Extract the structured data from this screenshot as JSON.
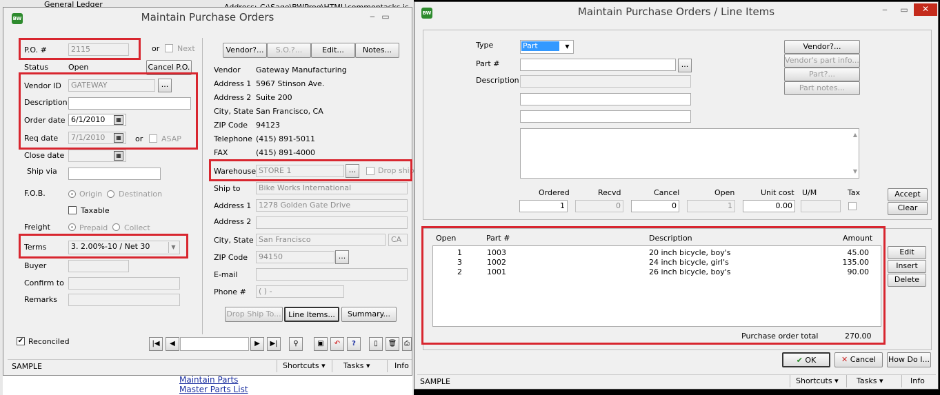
{
  "bg": {
    "gl_label": "General Ledger",
    "address_label": "Address:",
    "address_value": "C:\\Sage\\BWProg\\HTML\\commontasks.js.htm",
    "link1": "Maintain Parts",
    "link2": "Master Parts List"
  },
  "left": {
    "title": "Maintain Purchase Orders",
    "po_label": "P.O. #",
    "po_value": "2115",
    "or1": "or",
    "next": "Next",
    "status_label": "Status",
    "status_value": "Open",
    "cancel_po": "Cancel P.O.",
    "vendor_id_label": "Vendor ID",
    "vendor_id_value": "GATEWAY",
    "description_label": "Description",
    "description_value": "",
    "order_date_label": "Order date",
    "order_date_value": "6/1/2010",
    "req_date_label": "Req date",
    "req_date_value": "7/1/2010",
    "or2": "or",
    "asap": "ASAP",
    "close_date_label": "Close date",
    "ship_via_label": "Ship via",
    "fob_label": "F.O.B.",
    "origin": "Origin",
    "destination": "Destination",
    "taxable": "Taxable",
    "freight_label": "Freight",
    "prepaid": "Prepaid",
    "collect": "Collect",
    "terms_label": "Terms",
    "terms_value": "3. 2.00%-10 / Net 30",
    "buyer_label": "Buyer",
    "confirm_label": "Confirm to",
    "remarks_label": "Remarks",
    "reconciled": "Reconciled",
    "vendor_btn": "Vendor?...",
    "so_btn": "S.O.?...",
    "edit_btn": "Edit...",
    "notes_btn": "Notes...",
    "vendor_label": "Vendor",
    "vendor_value": "Gateway Manufacturing",
    "addr1_label": "Address 1",
    "addr1_value": "5967 Stinson Ave.",
    "addr2_label": "Address 2",
    "addr2_value": "Suite 200",
    "city_label": "City, State",
    "city_value": "San Francisco, CA",
    "zip_label": "ZIP Code",
    "zip_value": "94123",
    "tel_label": "Telephone",
    "tel_value": "(415) 891-5011",
    "fax_label": "FAX",
    "fax_value": "(415) 891-4000",
    "warehouse_label": "Warehouse",
    "warehouse_value": "STORE 1",
    "dropship": "Drop ship",
    "shipto_label": "Ship to",
    "shipto_value": "Bike Works International",
    "s_addr1_label": "Address 1",
    "s_addr1_value": "1278 Golden Gate Drive",
    "s_addr2_label": "Address 2",
    "s_addr2_value": "",
    "s_city_label": "City, State",
    "s_city_value": "San Francisco",
    "s_state_value": "CA",
    "s_zip_label": "ZIP Code",
    "s_zip_value": "94150",
    "email_label": "E-mail",
    "phone_label": "Phone #",
    "phone_value": "(   )    -",
    "dropshipto_btn": "Drop Ship To...",
    "lineitems_btn": "Line Items...",
    "summary_btn": "Summary...",
    "status_text": "SAMPLE",
    "shortcuts": "Shortcuts",
    "tasks": "Tasks",
    "info": "Info"
  },
  "right": {
    "title": "Maintain Purchase Orders / Line Items",
    "type_label": "Type",
    "type_value": "Part",
    "part_label": "Part #",
    "part_value": "",
    "desc_label": "Description",
    "vendor_btn": "Vendor?...",
    "vendor_part_btn": "Vendor's part info...",
    "part_btn": "Part?...",
    "part_notes_btn": "Part notes...",
    "col_ordered": "Ordered",
    "col_recvd": "Recvd",
    "col_cancel": "Cancel",
    "col_open": "Open",
    "col_unitcost": "Unit cost",
    "col_um": "U/M",
    "col_tax": "Tax",
    "val_ordered": "1",
    "val_recvd": "0",
    "val_cancel": "0",
    "val_open": "1",
    "val_unitcost": "0.00",
    "val_um": "",
    "accept_btn": "Accept",
    "clear_btn": "Clear",
    "list_headers": {
      "open": "Open",
      "part": "Part #",
      "desc": "Description",
      "amount": "Amount"
    },
    "rows": [
      {
        "open": "1",
        "part": "1003",
        "desc": "20 inch bicycle, boy's",
        "amount": "45.00"
      },
      {
        "open": "3",
        "part": "1002",
        "desc": "24 inch bicycle, girl's",
        "amount": "135.00"
      },
      {
        "open": "2",
        "part": "1001",
        "desc": "26 inch bicycle, boy's",
        "amount": "90.00"
      }
    ],
    "edit_btn": "Edit",
    "insert_btn": "Insert",
    "delete_btn": "Delete",
    "total_label": "Purchase order total",
    "total_value": "270.00",
    "ok_btn": "OK",
    "cancel_btn": "Cancel",
    "howdo_btn": "How Do I...",
    "status_text": "SAMPLE",
    "shortcuts": "Shortcuts",
    "tasks": "Tasks",
    "info": "Info"
  }
}
